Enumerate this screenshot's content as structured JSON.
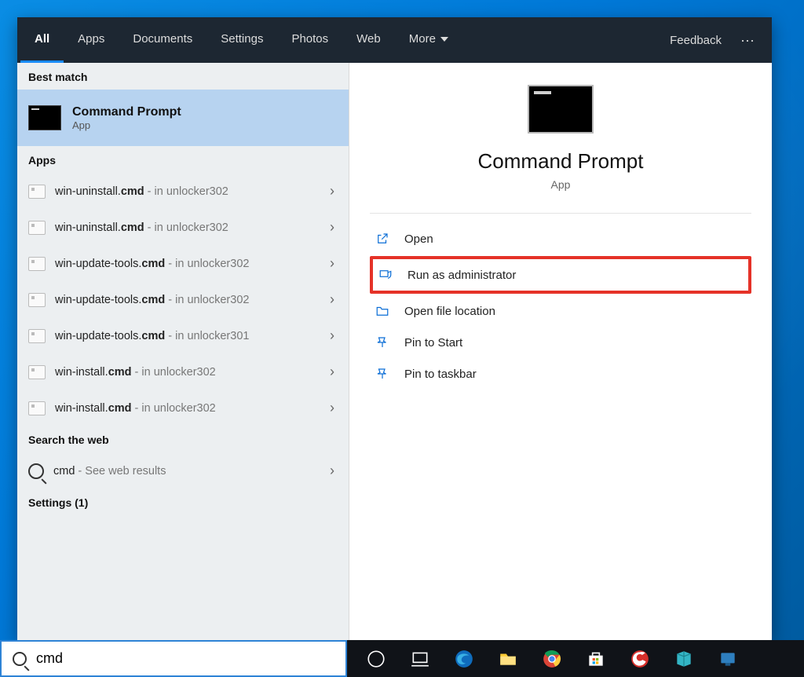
{
  "tabs": {
    "items": [
      "All",
      "Apps",
      "Documents",
      "Settings",
      "Photos",
      "Web",
      "More"
    ],
    "active_index": 0,
    "feedback": "Feedback"
  },
  "sections": {
    "best_match_label": "Best match",
    "apps_label": "Apps",
    "web_label": "Search the web",
    "settings_label": "Settings (1)"
  },
  "best_match": {
    "title": "Command Prompt",
    "subtitle": "App"
  },
  "app_results": [
    {
      "pre": "win-uninstall.",
      "bold": "cmd",
      "suf": " - in unlocker302"
    },
    {
      "pre": "win-uninstall.",
      "bold": "cmd",
      "suf": " - in unlocker302"
    },
    {
      "pre": "win-update-tools.",
      "bold": "cmd",
      "suf": " - in unlocker302"
    },
    {
      "pre": "win-update-tools.",
      "bold": "cmd",
      "suf": " - in unlocker302"
    },
    {
      "pre": "win-update-tools.",
      "bold": "cmd",
      "suf": " - in unlocker301"
    },
    {
      "pre": "win-install.",
      "bold": "cmd",
      "suf": " - in unlocker302"
    },
    {
      "pre": "win-install.",
      "bold": "cmd",
      "suf": " - in unlocker302"
    }
  ],
  "web_result": {
    "bold": "cmd",
    "suf": " - See web results"
  },
  "preview": {
    "title": "Command Prompt",
    "subtitle": "App"
  },
  "actions": {
    "open": "Open",
    "run_admin": "Run as administrator",
    "open_loc": "Open file location",
    "pin_start": "Pin to Start",
    "pin_taskbar": "Pin to taskbar"
  },
  "search": {
    "value": "cmd"
  }
}
